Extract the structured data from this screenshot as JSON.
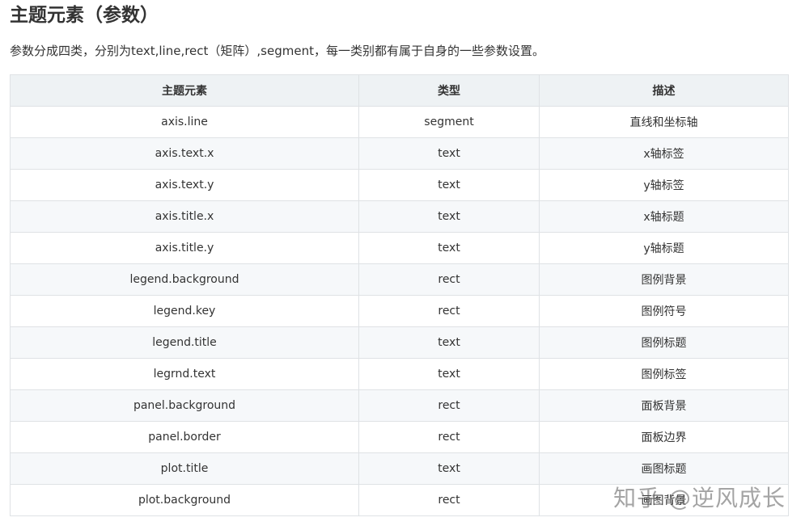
{
  "heading": "主题元素（参数）",
  "intro": "参数分成四类，分别为text,line,rect（矩阵）,segment，每一类别都有属于自身的一些参数设置。",
  "table": {
    "headers": [
      "主题元素",
      "类型",
      "描述"
    ],
    "rows": [
      [
        "axis.line",
        "segment",
        "直线和坐标轴"
      ],
      [
        "axis.text.x",
        "text",
        "x轴标签"
      ],
      [
        "axis.text.y",
        "text",
        "y轴标签"
      ],
      [
        "axis.title.x",
        "text",
        "x轴标题"
      ],
      [
        "axis.title.y",
        "text",
        "y轴标题"
      ],
      [
        "legend.background",
        "rect",
        "图例背景"
      ],
      [
        "legend.key",
        "rect",
        "图例符号"
      ],
      [
        "legend.title",
        "text",
        "图例标题"
      ],
      [
        "legrnd.text",
        "text",
        "图例标签"
      ],
      [
        "panel.background",
        "rect",
        "面板背景"
      ],
      [
        "panel.border",
        "rect",
        "面板边界"
      ],
      [
        "plot.title",
        "text",
        "画图标题"
      ],
      [
        "plot.background",
        "rect",
        "画图背景"
      ]
    ]
  },
  "watermark": "知乎 @逆风成长",
  "colors": {
    "header_bg": "#eef2f4",
    "stripe_bg": "#f6f8fa",
    "border": "#dfe2e5",
    "text": "#333333"
  }
}
